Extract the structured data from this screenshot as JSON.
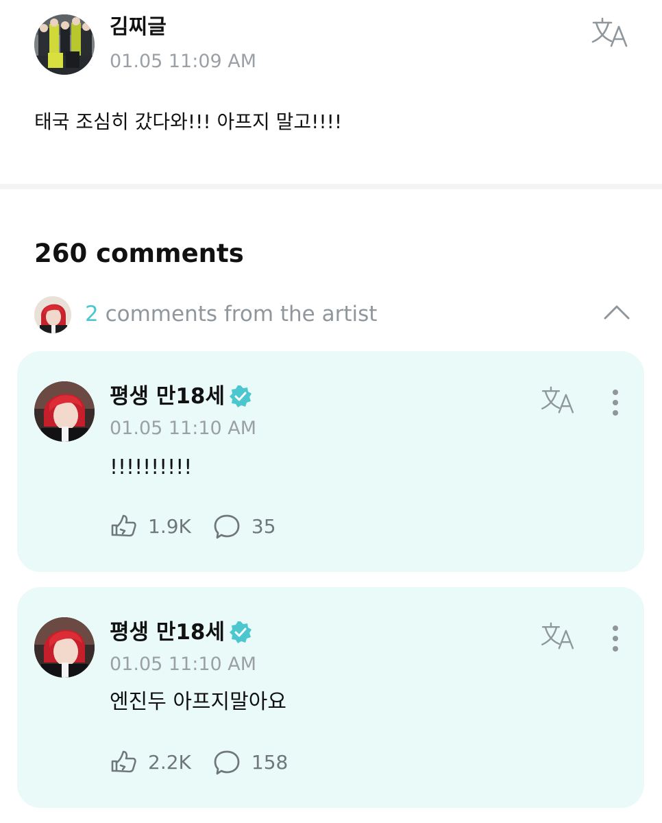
{
  "post": {
    "author": "김찌글",
    "time": "01.05 11:09 AM",
    "text": "태국 조심히 갔다와!!! 아프지 말고!!!!",
    "translate_icon": "translate-icon"
  },
  "comments": {
    "total_label": "260 comments",
    "artist_count": "2",
    "artist_label": " comments from the artist",
    "chevron_icon": "chevron-up-icon"
  },
  "artist_comments": [
    {
      "name": "평생 만18세",
      "time": "01.05 11:10 AM",
      "text": "!!!!!!!!!!",
      "likes": "1.9K",
      "replies": "35"
    },
    {
      "name": "평생 만18세",
      "time": "01.05 11:10 AM",
      "text": "엔진두 아프지말아요",
      "likes": "2.2K",
      "replies": "158"
    }
  ],
  "colors": {
    "accent": "#4cc6cf",
    "card_background": "#e9faf8",
    "muted_text": "#9aa0a6",
    "icon_gray": "#6f777d"
  }
}
